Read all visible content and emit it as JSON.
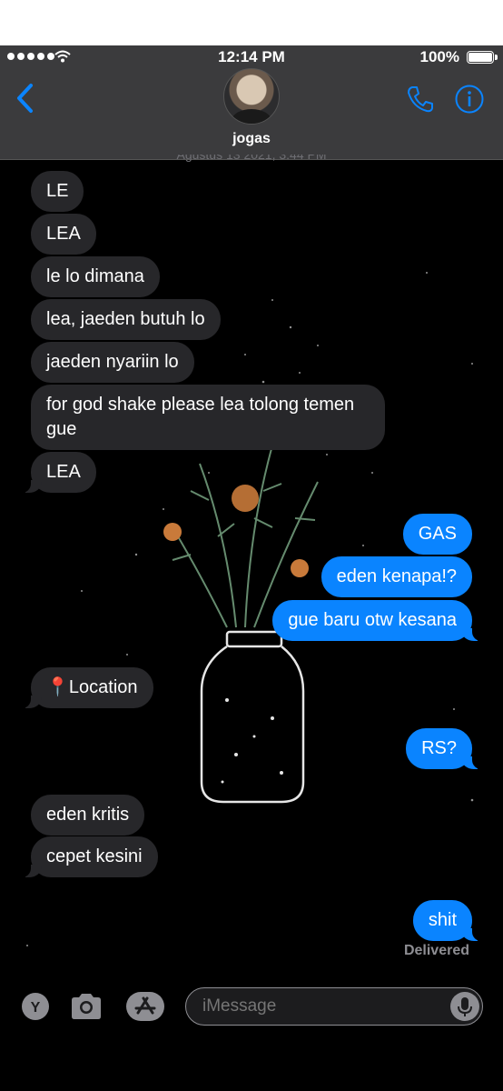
{
  "status_bar": {
    "time": "12:14 PM",
    "battery": "100%"
  },
  "contact": {
    "name": "jogas"
  },
  "thread": {
    "obscured_timestamp": "Agustus 13 2021, 3:44 PM",
    "messages": [
      {
        "from": "them",
        "text": "LE"
      },
      {
        "from": "them",
        "text": "LEA"
      },
      {
        "from": "them",
        "text": "le lo dimana"
      },
      {
        "from": "them",
        "text": "lea, jaeden butuh lo"
      },
      {
        "from": "them",
        "text": "jaeden nyariin lo"
      },
      {
        "from": "them",
        "text": "for god shake please lea tolong temen gue"
      },
      {
        "from": "them",
        "text": "LEA"
      },
      {
        "from": "me",
        "text": "GAS"
      },
      {
        "from": "me",
        "text": "eden kenapa!?"
      },
      {
        "from": "me",
        "text": "gue baru otw kesana"
      },
      {
        "from": "them",
        "text": "📍Location"
      },
      {
        "from": "me",
        "text": "RS?"
      },
      {
        "from": "them",
        "text": "eden kritis"
      },
      {
        "from": "them",
        "text": "cepet kesini"
      },
      {
        "from": "me",
        "text": "shit"
      }
    ],
    "delivered_label": "Delivered"
  },
  "input_bar": {
    "placeholder": "iMessage",
    "memoji_letter": "Y"
  },
  "colors": {
    "sent": "#0a84ff",
    "received": "#27272a",
    "accent": "#0a84ff"
  },
  "icons": [
    "back-chevron-icon",
    "phone-icon",
    "info-icon",
    "camera-icon",
    "app-store-icon",
    "microphone-icon"
  ]
}
